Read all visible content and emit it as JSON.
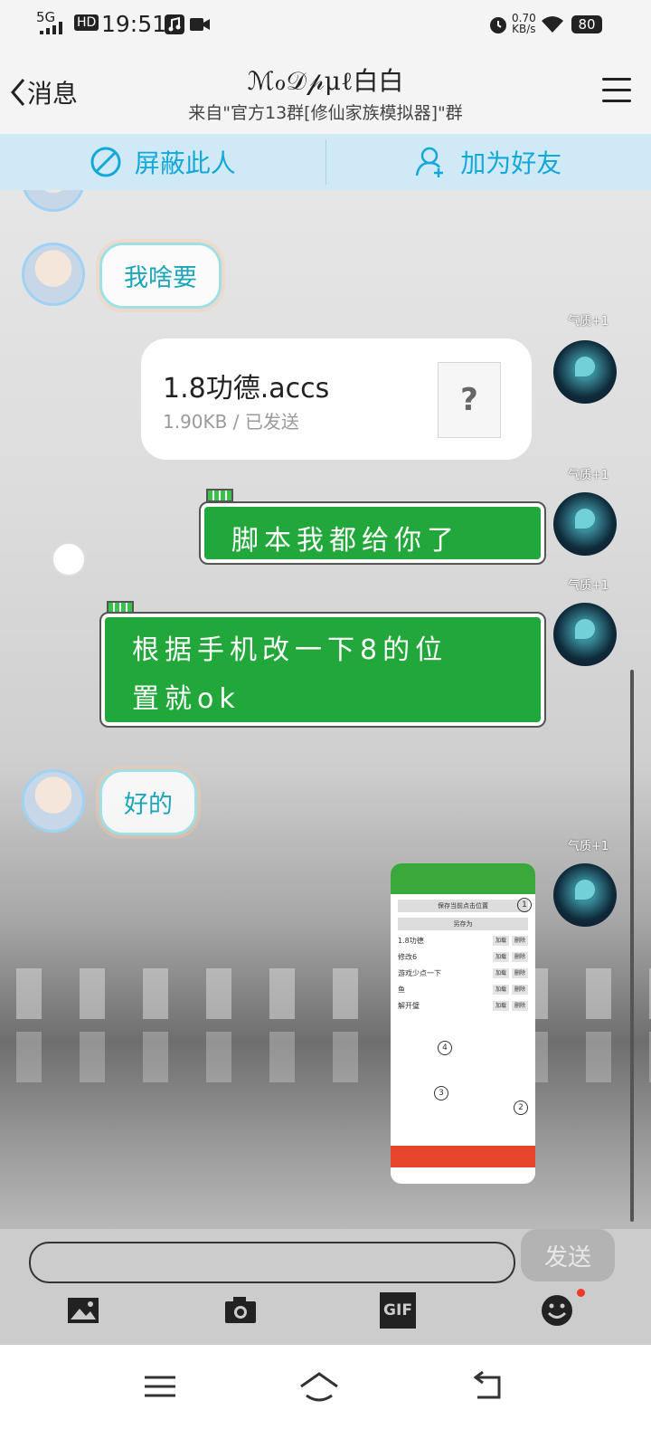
{
  "status_bar": {
    "network": "5G",
    "hd": "HD",
    "time": "19:51",
    "speed_value": "0.70",
    "speed_unit": "KB/s",
    "battery": "80"
  },
  "header": {
    "back_label": "消息",
    "title": "ℳℴ𝒟𝓅μℓ白白",
    "subtitle": "来自\"官方13群[修仙家族模拟器]\"群"
  },
  "actions": {
    "block_label": "屏蔽此人",
    "add_friend_label": "加为好友"
  },
  "messages": {
    "m1_text": "我啥要",
    "file_name": "1.8功德.accs",
    "file_meta": "1.90KB / 已发送",
    "file_placeholder": "?",
    "m3_text": "脚本我都给你了",
    "m4_line1": "根据手机改一下8的位",
    "m4_line2": "置就ok",
    "m5_text": "好的",
    "badge_text": "气质+1"
  },
  "screenshot": {
    "btn_save_pos": "保存当前点击位置",
    "btn_save_as": "另存为",
    "rows": [
      {
        "name": "1.8功德",
        "b1": "加载",
        "b2": "删除"
      },
      {
        "name": "修改6",
        "b1": "加载",
        "b2": "删除"
      },
      {
        "name": "游戏少点一下",
        "b1": "加载",
        "b2": "删除"
      },
      {
        "name": "鱼",
        "b1": "加载",
        "b2": "删除"
      },
      {
        "name": "解开璧",
        "b1": "加载",
        "b2": "删除"
      }
    ],
    "targets": [
      "1",
      "2",
      "3",
      "4"
    ]
  },
  "input": {
    "placeholder": "",
    "send_label": "发送"
  },
  "toolbar": {
    "icons": [
      "image-icon",
      "camera-icon",
      "gif-icon",
      "emoji-icon"
    ],
    "gif_label": "GIF"
  },
  "colors": {
    "accent_blue": "#13a8d8",
    "bubble_green": "#22a83a",
    "send_disabled": "#b3b3b3"
  }
}
